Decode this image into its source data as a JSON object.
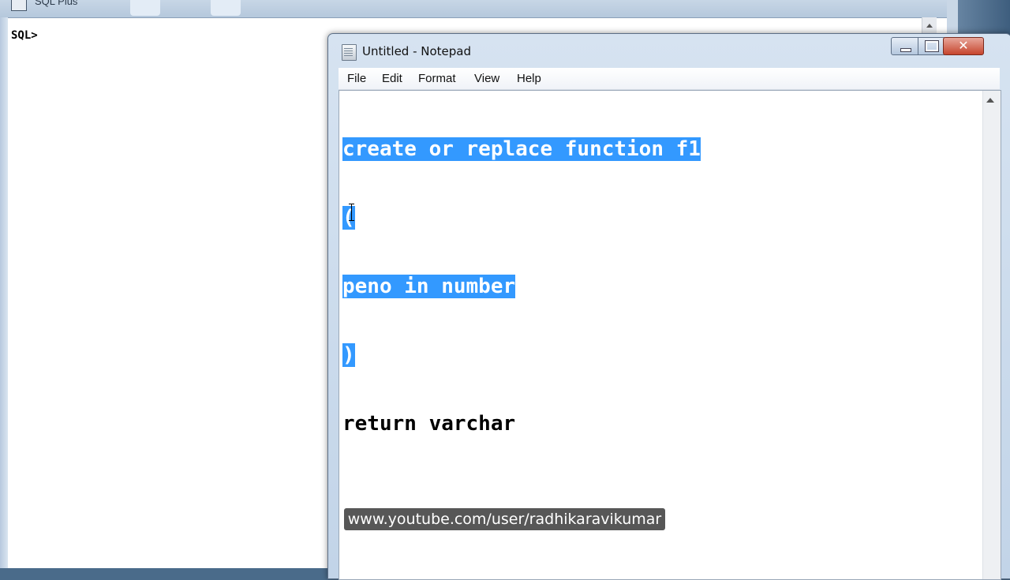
{
  "sqlplus": {
    "title": "SQL Plus",
    "prompt": "SQL>"
  },
  "notepad": {
    "title": "Untitled - Notepad",
    "menu": [
      "File",
      "Edit",
      "Format",
      "View",
      "Help"
    ],
    "close_glyph": "✕",
    "lines": [
      {
        "text": "create or replace function f1",
        "selected": true
      },
      {
        "text": "(",
        "selected": true
      },
      {
        "text": "peno in number",
        "selected": true
      },
      {
        "text": ")",
        "selected": true
      },
      {
        "text": "return varchar",
        "selected": false
      }
    ],
    "selection_color": "#3399ff"
  },
  "watermark": "www.youtube.com/user/radhikaravikumar",
  "icons": {
    "notepad_app": "notepad-icon",
    "sqlplus_app": "sqlplus-icon",
    "minimize": "minimize-icon",
    "maximize": "maximize-icon",
    "close": "close-icon",
    "cursor": "ibeam-cursor-icon",
    "scroll_up": "scroll-up-arrow-icon"
  }
}
